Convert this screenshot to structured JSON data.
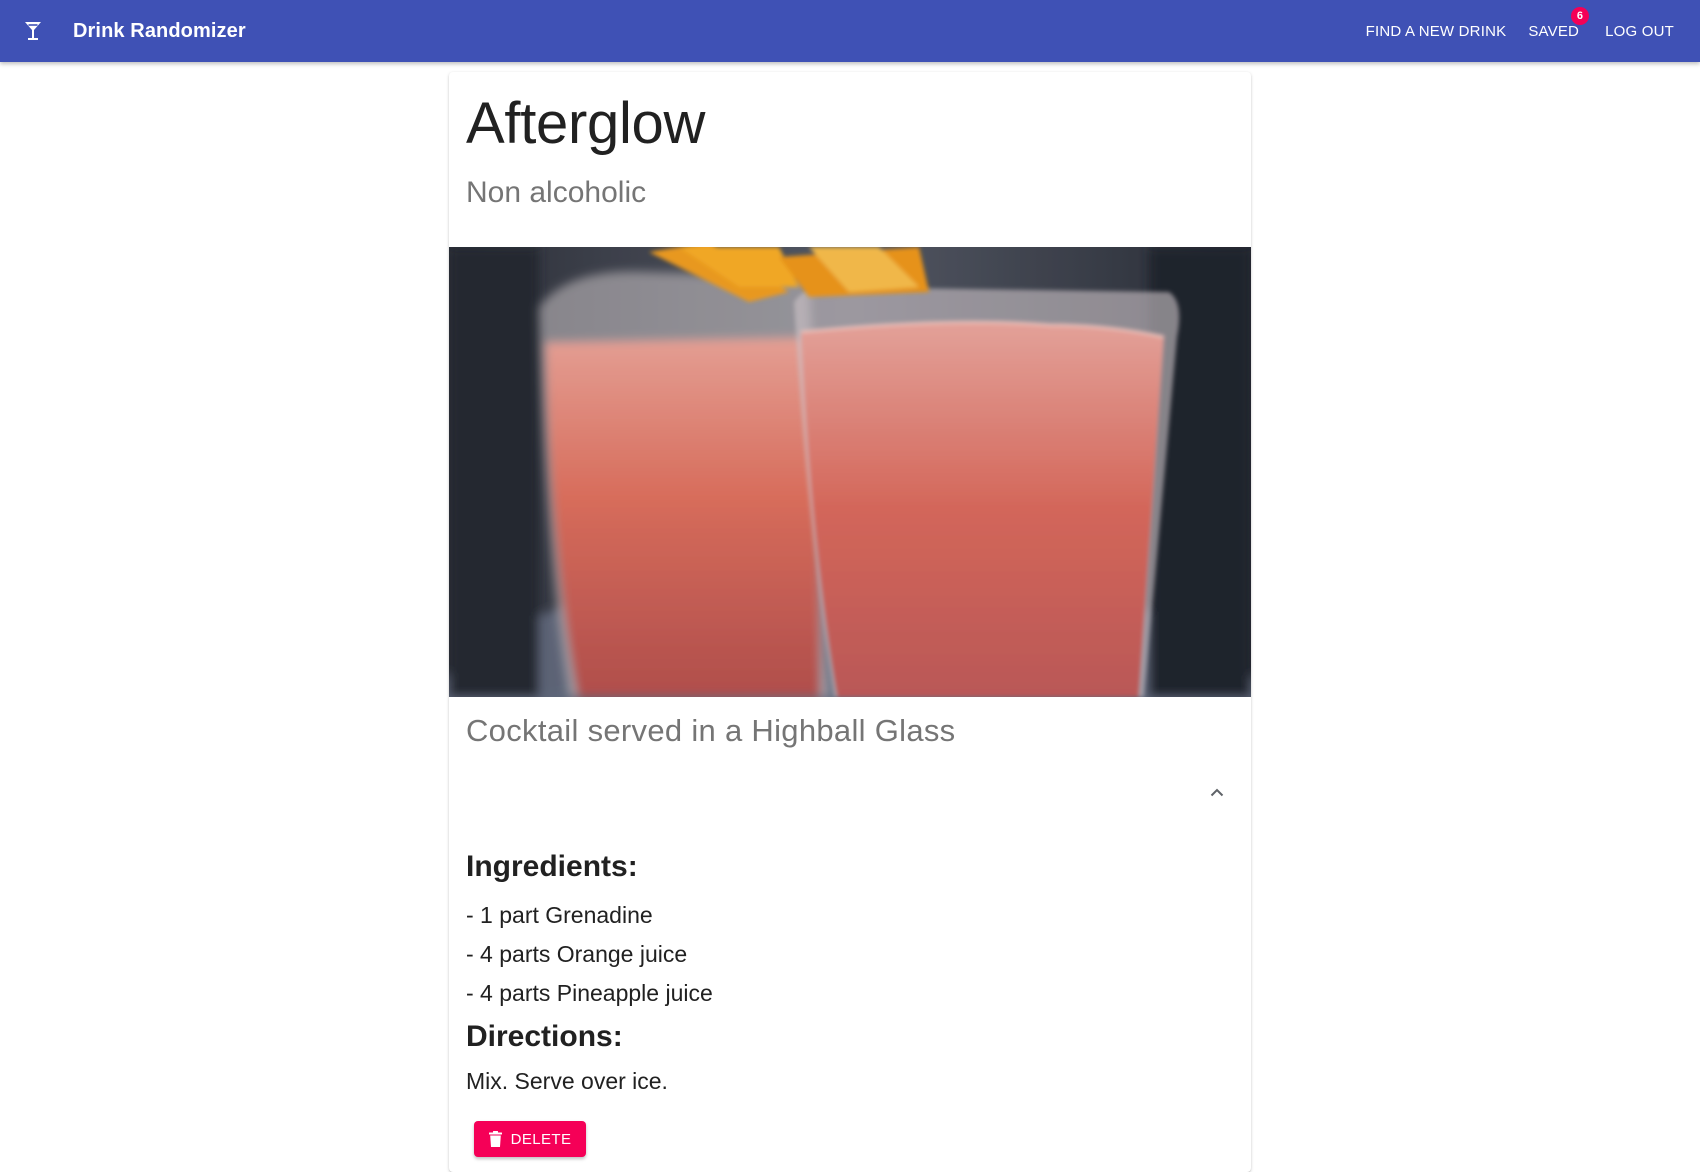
{
  "appbar": {
    "icon": "cocktail-glass-icon",
    "title": "Drink Randomizer",
    "color": "#3f51b5",
    "nav": {
      "find_label": "FIND A NEW DRINK",
      "saved_label": "SAVED",
      "saved_count": "6",
      "logout_label": "LOG OUT"
    }
  },
  "drink": {
    "name": "Afterglow",
    "category": "Non alcoholic",
    "image_icon": "drink-photo",
    "glass": "Cocktail served in a Highball Glass",
    "ingredients_heading": "Ingredients:",
    "ingredients": [
      "- 1 part Grenadine",
      "- 4 parts Orange juice",
      "- 4 parts Pineapple juice"
    ],
    "directions_heading": "Directions:",
    "directions": "Mix. Serve over ice.",
    "expand_icon": "chevron-up-icon"
  },
  "actions": {
    "delete_label": "DELETE",
    "delete_icon": "trash-icon",
    "delete_color": "#f50057"
  }
}
